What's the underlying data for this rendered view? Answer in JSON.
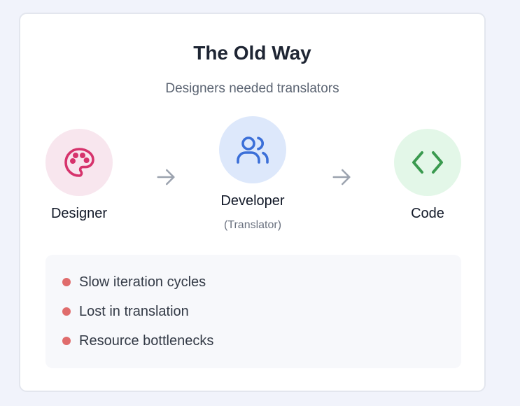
{
  "card": {
    "title": "The Old Way",
    "subtitle": "Designers needed translators"
  },
  "flow": {
    "nodes": [
      {
        "label": "Designer",
        "sublabel": "",
        "icon": "palette-icon",
        "circle_color": "#f8e6ee",
        "icon_color": "#d6336c"
      },
      {
        "label": "Developer",
        "sublabel": "(Translator)",
        "icon": "users-icon",
        "circle_color": "#dde8fb",
        "icon_color": "#3b6fd8"
      },
      {
        "label": "Code",
        "sublabel": "",
        "icon": "code-icon",
        "circle_color": "#e3f7e8",
        "icon_color": "#3a9a4f"
      }
    ],
    "arrow_icon": "arrow-right-icon",
    "arrow_color": "#9ca3af"
  },
  "problems": {
    "dot_color": "#e06c6c",
    "items": [
      "Slow iteration cycles",
      "Lost in translation",
      "Resource bottlenecks"
    ]
  }
}
